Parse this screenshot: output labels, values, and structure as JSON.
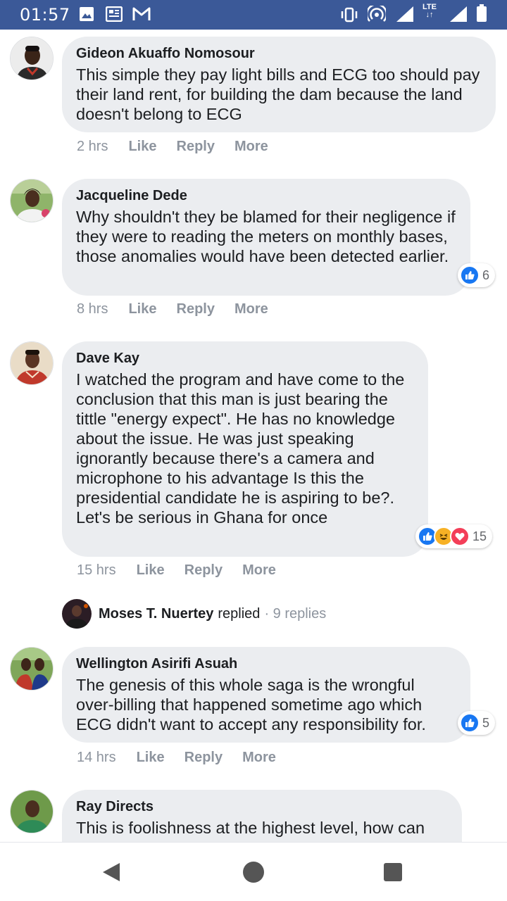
{
  "status_bar": {
    "time": "01:57",
    "network_label": "LTE",
    "icons": [
      "image-icon",
      "news-icon",
      "gmail-icon",
      "vibrate-icon",
      "hotspot-icon",
      "signal-icon",
      "lte-signal-icon",
      "battery-icon"
    ]
  },
  "comments": [
    {
      "author": "Gideon Akuaffo Nomosour",
      "text": "This simple they pay light bills and ECG too should pay their land rent, for building the dam because the land doesn't belong to ECG",
      "time": "2 hrs",
      "actions": {
        "like": "Like",
        "reply": "Reply",
        "more": "More"
      }
    },
    {
      "author": "Jacqueline Dede",
      "text": "Why shouldn't they be blamed for their negligence if they were to reading the meters on monthly bases, those anomalies would have been detected earlier.",
      "time": "8 hrs",
      "actions": {
        "like": "Like",
        "reply": "Reply",
        "more": "More"
      },
      "reactions": {
        "types": [
          "like"
        ],
        "count": "6"
      }
    },
    {
      "author": "Dave Kay",
      "text": "I watched the program and have come to the conclusion that this man is just bearing the tittle \"energy expect\". He has no knowledge about the issue. He was just speaking ignorantly because there's a camera and microphone to his advantage Is this the presidential candidate he is aspiring to be?. Let's be serious in Ghana for once",
      "time": "15 hrs",
      "actions": {
        "like": "Like",
        "reply": "Reply",
        "more": "More"
      },
      "reactions": {
        "types": [
          "like",
          "haha",
          "love"
        ],
        "count": "15"
      },
      "replies": {
        "name": "Moses T. Nuertey",
        "verb": "replied",
        "count": "· 9 replies"
      }
    },
    {
      "author": "Wellington Asirifi Asuah",
      "text": "The genesis of this whole saga is the wrongful over-billing that happened sometime ago which ECG didn't want to accept any responsibility for.",
      "time": "14 hrs",
      "actions": {
        "like": "Like",
        "reply": "Reply",
        "more": "More"
      },
      "reactions": {
        "types": [
          "like"
        ],
        "count": "5"
      }
    },
    {
      "author": "Ray Directs",
      "text": "This is foolishness at the highest level, how can"
    }
  ],
  "colors": {
    "status_bar": "#3b5998",
    "bubble": "#ebedf0",
    "meta_text": "#8d949e",
    "like_blue": "#1877f2",
    "love_red": "#f33e58",
    "haha_yellow": "#f7b125"
  },
  "nav_bar": {
    "icons": [
      "back-icon",
      "home-icon",
      "recents-icon"
    ]
  }
}
